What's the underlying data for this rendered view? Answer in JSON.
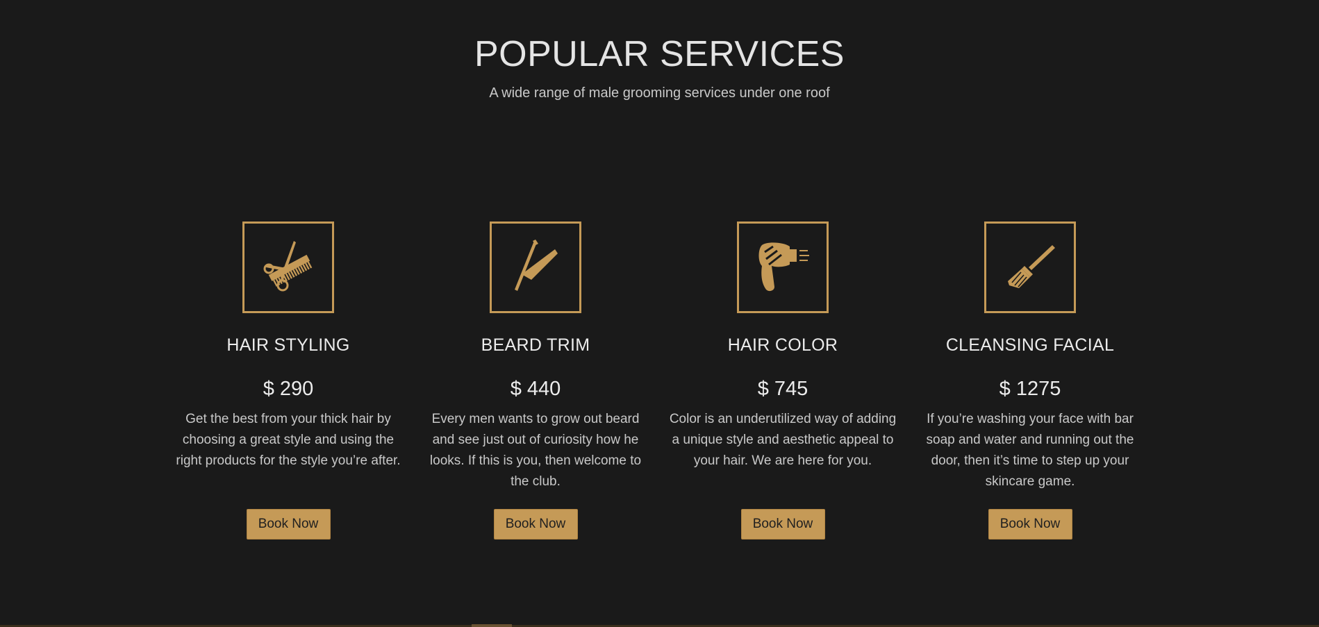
{
  "header": {
    "title": "POPULAR SERVICES",
    "subtitle": "A wide range of male grooming services under one roof"
  },
  "theme": {
    "background": "#1a1a1a",
    "accent": "#c59a57",
    "text": "#ececec"
  },
  "services": [
    {
      "icon": "scissors-comb-icon",
      "name": "HAIR STYLING",
      "price": "$ 290",
      "description": "Get the best from your thick hair by choosing a great style and using the right products for the style you’re after.",
      "button_label": "Book Now"
    },
    {
      "icon": "straight-razor-icon",
      "name": "BEARD TRIM",
      "price": "$ 440",
      "description": "Every men wants to grow out beard and see just out of curiosity how he looks. If this is you, then welcome to the club.",
      "button_label": "Book Now"
    },
    {
      "icon": "hair-dryer-icon",
      "name": "HAIR COLOR",
      "price": "$ 745",
      "description": "Color is an underutilized way of adding a unique style and aesthetic appeal to your hair. We are here for you.",
      "button_label": "Book Now"
    },
    {
      "icon": "dye-brush-icon",
      "name": "CLEANSING FACIAL",
      "price": "$ 1275",
      "description": "If you’re washing your face with bar soap and water and running out the door, then it’s time to step up your skincare game.",
      "button_label": "Book Now"
    }
  ]
}
